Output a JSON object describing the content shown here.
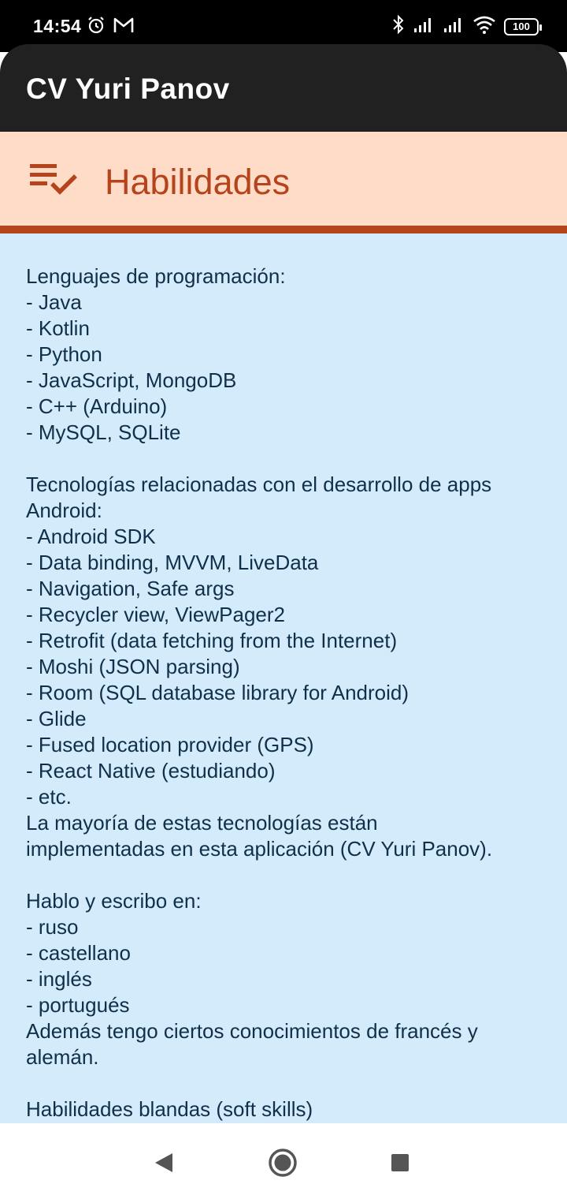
{
  "status_bar": {
    "time": "14:54",
    "battery": "100",
    "icons": [
      "alarm-icon",
      "gmail-icon",
      "bluetooth-icon",
      "signal-icon",
      "signal-icon",
      "wifi-icon",
      "battery-icon"
    ]
  },
  "app_bar": {
    "title": "CV Yuri Panov"
  },
  "section": {
    "icon": "playlist-check-icon",
    "title": "Habilidades"
  },
  "content": {
    "lines": [
      "Lenguajes de programación:",
      "- Java",
      "- Kotlin",
      "- Python",
      "- JavaScript, MongoDB",
      "- C++ (Arduino)",
      "- MySQL, SQLite",
      "",
      "Tecnologías relacionadas con el desarrollo de apps",
      "Android:",
      "- Android SDK",
      "- Data binding, MVVM, LiveData",
      "- Navigation, Safe args",
      "- Recycler view, ViewPager2",
      "- Retrofit (data fetching from the Internet)",
      "- Moshi (JSON parsing)",
      "- Room (SQL database library for Android)",
      "- Glide",
      "- Fused location provider (GPS)",
      "- React Native (estudiando)",
      "- etc.",
      "La mayoría de estas tecnologías están",
      "implementadas en esta aplicación (CV Yuri Panov).",
      "",
      "Hablo y escribo en:",
      "- ruso",
      "- castellano",
      "- inglés",
      "- portugués",
      "Además tengo ciertos conocimientos de francés y",
      "alemán.",
      "",
      "Habilidades blandas (soft skills)"
    ]
  },
  "nav_bar": {
    "buttons": [
      "back-icon",
      "home-icon",
      "recents-icon"
    ]
  },
  "colors": {
    "status_bar_bg": "#000000",
    "app_bar_bg": "#212121",
    "section_bg": "#ffdcc8",
    "section_accent": "#b5441c",
    "content_bg": "#d4ebfb",
    "content_text": "#10304a"
  }
}
